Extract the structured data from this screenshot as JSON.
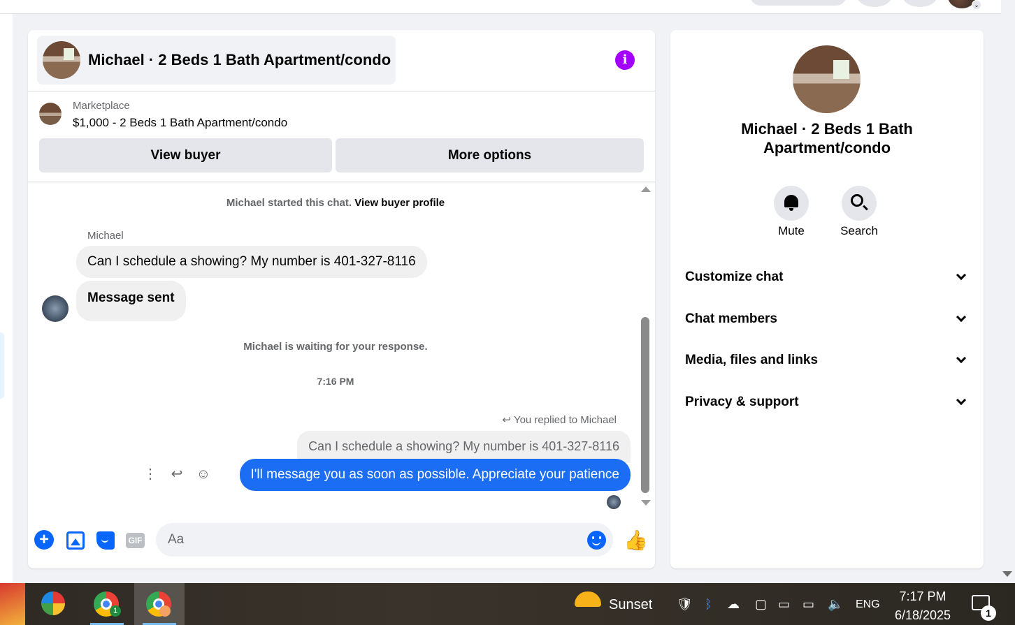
{
  "chat": {
    "title": "Michael · 2 Beds 1 Bath Apartment/condo",
    "marketplace_label": "Marketplace",
    "listing_price_title": "$1,000 - 2 Beds 1 Bath Apartment/condo",
    "view_buyer_label": "View buyer",
    "more_options_label": "More options",
    "started_text": "Michael started this chat.",
    "view_buyer_profile": "View buyer profile",
    "sender_name": "Michael",
    "messages_in": [
      "Can I schedule a showing? My number is 401-327-8116",
      "Message sent"
    ],
    "waiting_text": "Michael is waiting for your response.",
    "timestamp": "7:16 PM",
    "replied_label": "You replied to Michael",
    "quoted_text": "Can I schedule a showing? My number is 401-327-8116",
    "message_out": "I'll message you as soon as possible. Appreciate your patience",
    "composer_placeholder": "Aa",
    "gif_label": "GIF",
    "accent_color": "#0866ff"
  },
  "info_panel": {
    "title": "Michael · 2 Beds 1 Bath Apartment/condo",
    "actions": [
      {
        "label": "Mute",
        "icon": "bell-icon"
      },
      {
        "label": "Search",
        "icon": "search-icon"
      }
    ],
    "sections": [
      "Customize chat",
      "Chat members",
      "Media, files and links",
      "Privacy & support"
    ]
  },
  "taskbar": {
    "weather_label": "Sunset",
    "language": "ENG",
    "time": "7:17 PM",
    "date": "6/18/2025",
    "notification_count": "1",
    "chrome_badge_count": "1"
  }
}
